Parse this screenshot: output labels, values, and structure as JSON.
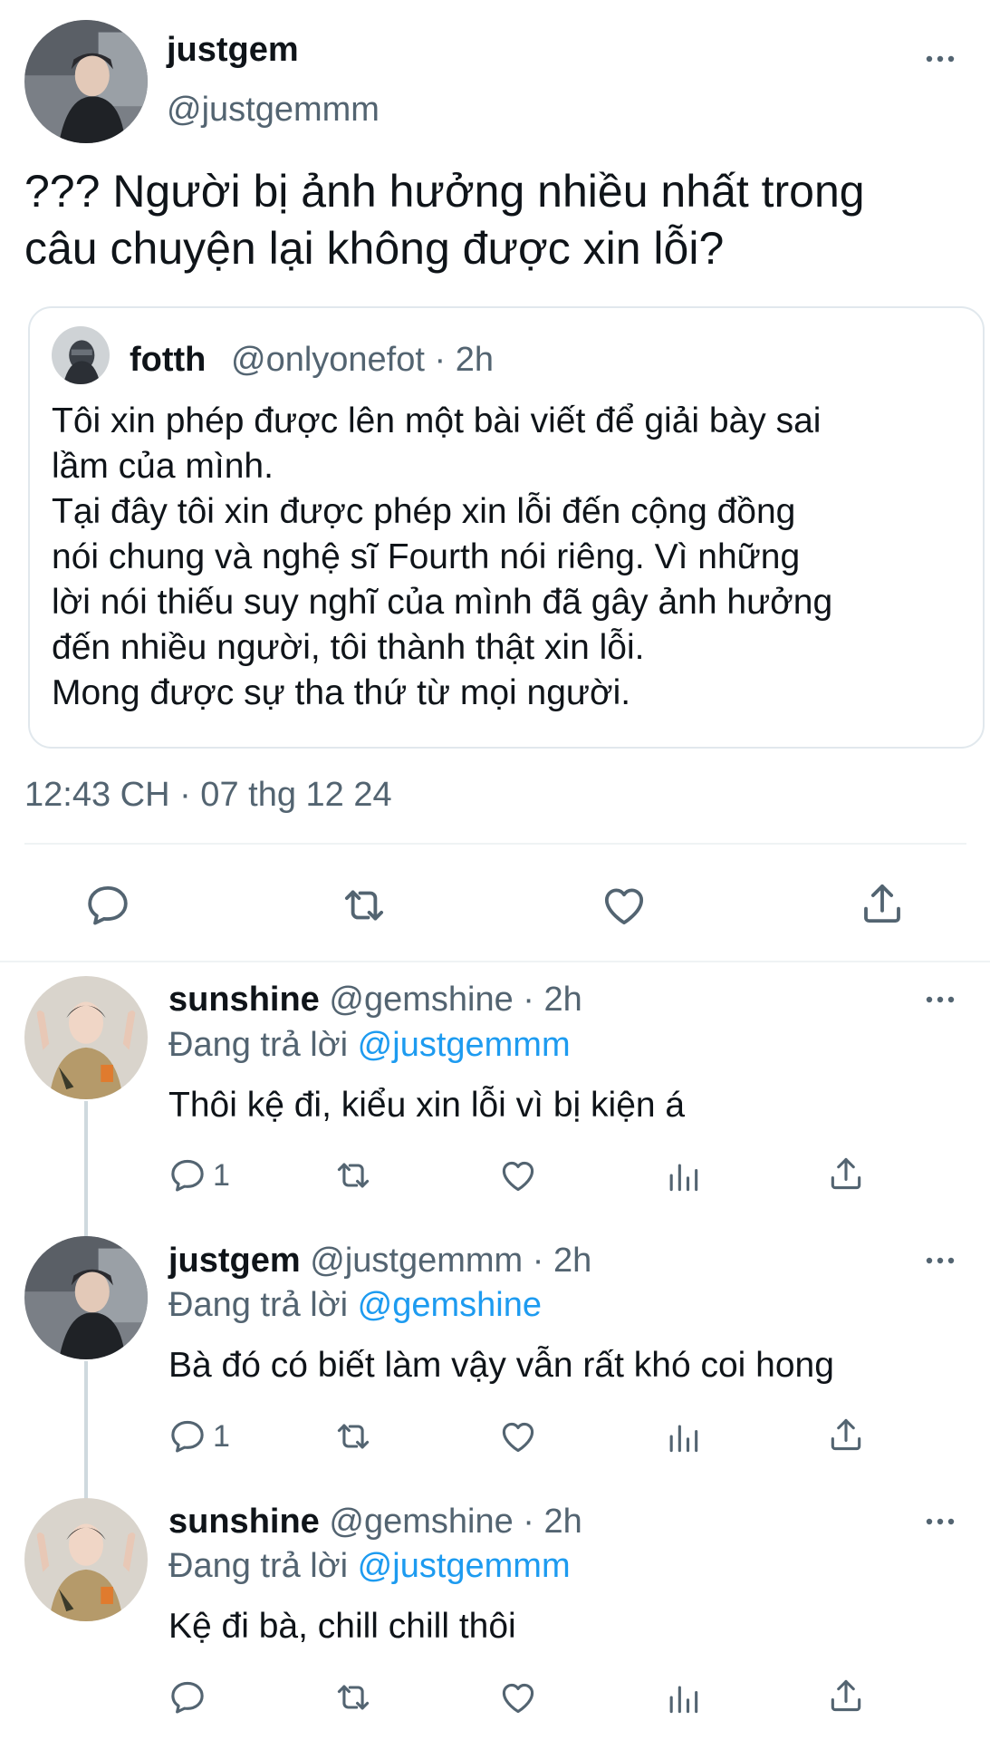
{
  "main_tweet": {
    "display_name": "justgem",
    "handle": "@justgemmm",
    "text": "??? Người bị ảnh hưởng nhiều nhất trong\ncâu chuyện lại không được xin lỗi?",
    "timestamp": "12:43 CH · 07 thg 12 24",
    "actions": [
      "reply-icon",
      "retweet-icon",
      "like-icon",
      "share-icon"
    ]
  },
  "quoted_tweet": {
    "display_name": "fotth",
    "meta": "@onlyonefot · 2h",
    "text": "Tôi xin phép được lên một bài viết để giải bày sai\nlầm của mình.\nTại đây tôi xin được phép xin lỗi đến cộng đồng\nnói chung và nghệ sĩ Fourth nói riêng. Vì những\nlời nói thiếu suy nghĩ của mình đã gây ảnh hưởng\nđến nhiều người, tôi thành thật xin lỗi.\nMong được sự tha thứ từ mọi người."
  },
  "replies": [
    {
      "display_name": "sunshine",
      "meta": "@gemshine · 2h",
      "replying_label": "Đang trả lời",
      "replying_to": "@justgemmm",
      "text": "Thôi kệ đi, kiểu xin lỗi vì bị kiện á",
      "reply_count": "1"
    },
    {
      "display_name": "justgem",
      "meta": "@justgemmm · 2h",
      "replying_label": "Đang trả lời",
      "replying_to": "@gemshine",
      "text": "Bà đó có biết làm vậy vẫn rất khó coi hong",
      "reply_count": "1"
    },
    {
      "display_name": "sunshine",
      "meta": "@gemshine · 2h",
      "replying_label": "Đang trả lời",
      "replying_to": "@justgemmm",
      "text": "Kệ đi bà, chill chill thôi",
      "reply_count": ""
    }
  ],
  "colors": {
    "text": "#0f1419",
    "secondary": "#536471",
    "link": "#1d9bf0",
    "border": "#e1e8ed"
  }
}
